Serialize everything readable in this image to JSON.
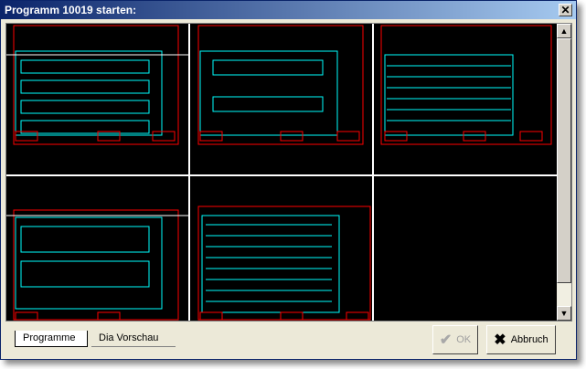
{
  "window": {
    "title": "Programm 10019 starten:"
  },
  "tabs": [
    {
      "label": "Programme"
    },
    {
      "label": "Dia Vorschau"
    }
  ],
  "buttons": {
    "ok": "OK",
    "cancel": "Abbruch"
  },
  "colors": {
    "preview_bg": "#000000",
    "drawing_primary": "#00ffff",
    "drawing_frame": "#ff0000",
    "grid_lines": "#ffffff"
  },
  "icons": {
    "close": "close-icon",
    "ok": "checkmark-icon",
    "cancel": "x-icon"
  }
}
